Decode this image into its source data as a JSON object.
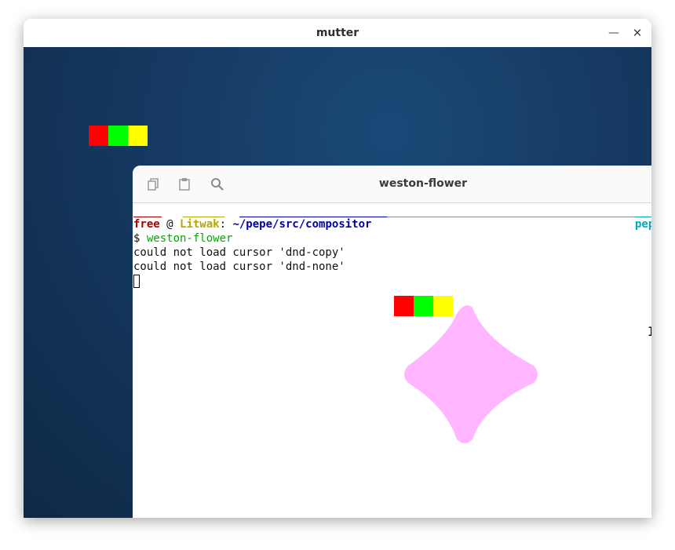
{
  "outer_window": {
    "title": "mutter",
    "minimize_icon": "minimize-icon",
    "close_icon": "close-icon",
    "minimize_glyph": "—",
    "close_glyph": "✕"
  },
  "desktop": {
    "background": "#163b64",
    "test_strip_colors": [
      "#ff0000",
      "#00ff00",
      "#ffff00"
    ]
  },
  "terminal": {
    "title": "weston-flower",
    "header_icons": [
      "copy-icon",
      "paste-icon",
      "search-icon"
    ],
    "prompt": {
      "user": "free",
      "at": " @ ",
      "host": "Litwak",
      "colon": ": ",
      "path": "~/pepe/src/compositor",
      "right_fragment": "pep"
    },
    "command_line": {
      "symbol": "$ ",
      "command": "weston-flower"
    },
    "output_lines": [
      "could not load cursor 'dnd-copy'",
      "could not load cursor 'dnd-none'"
    ]
  },
  "flower_window": {
    "shape_color": "#ffb5ff",
    "test_strip_colors": [
      "#ff0000",
      "#00ff00",
      "#ffff00"
    ]
  },
  "colors": {
    "prompt_user": "#aa0000",
    "prompt_host": "#b5a800",
    "prompt_path": "#0000aa",
    "command": "#00aa00",
    "accent_cyan": "#00a8b8"
  }
}
